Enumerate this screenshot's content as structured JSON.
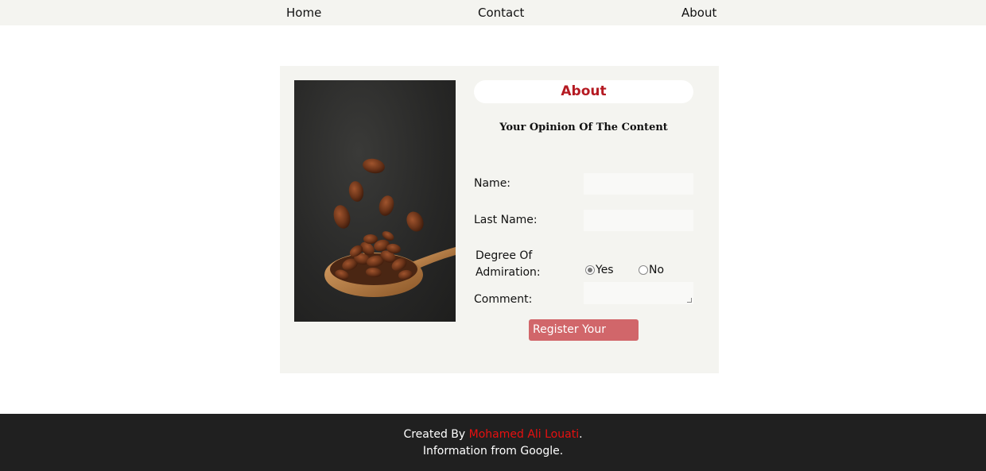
{
  "nav": {
    "items": [
      {
        "label": "Home"
      },
      {
        "label": "Contact"
      },
      {
        "label": "About"
      }
    ]
  },
  "card": {
    "title": "About",
    "subtitle": "Your Opinion Of The Content",
    "form": {
      "name_label": "Name:",
      "name_value": "",
      "lastname_label": "Last Name:",
      "lastname_value": "",
      "degree_label_line1": "Degree Of",
      "degree_label_line2": "Admiration:",
      "options": [
        {
          "label": "Yes",
          "checked": true
        },
        {
          "label": "No",
          "checked": false
        }
      ],
      "comment_label": "Comment:",
      "comment_value": "",
      "submit_label": "Register Your"
    }
  },
  "footer": {
    "created_prefix": "Created By ",
    "author": "Mohamed Ali Louati",
    "created_suffix": ".",
    "info": "Information from Google."
  },
  "colors": {
    "accent_red": "#b51a22",
    "button": "#d1666a",
    "author_link": "#e81010",
    "footer_bg": "#202020",
    "panel_bg": "#f4f4f0"
  }
}
